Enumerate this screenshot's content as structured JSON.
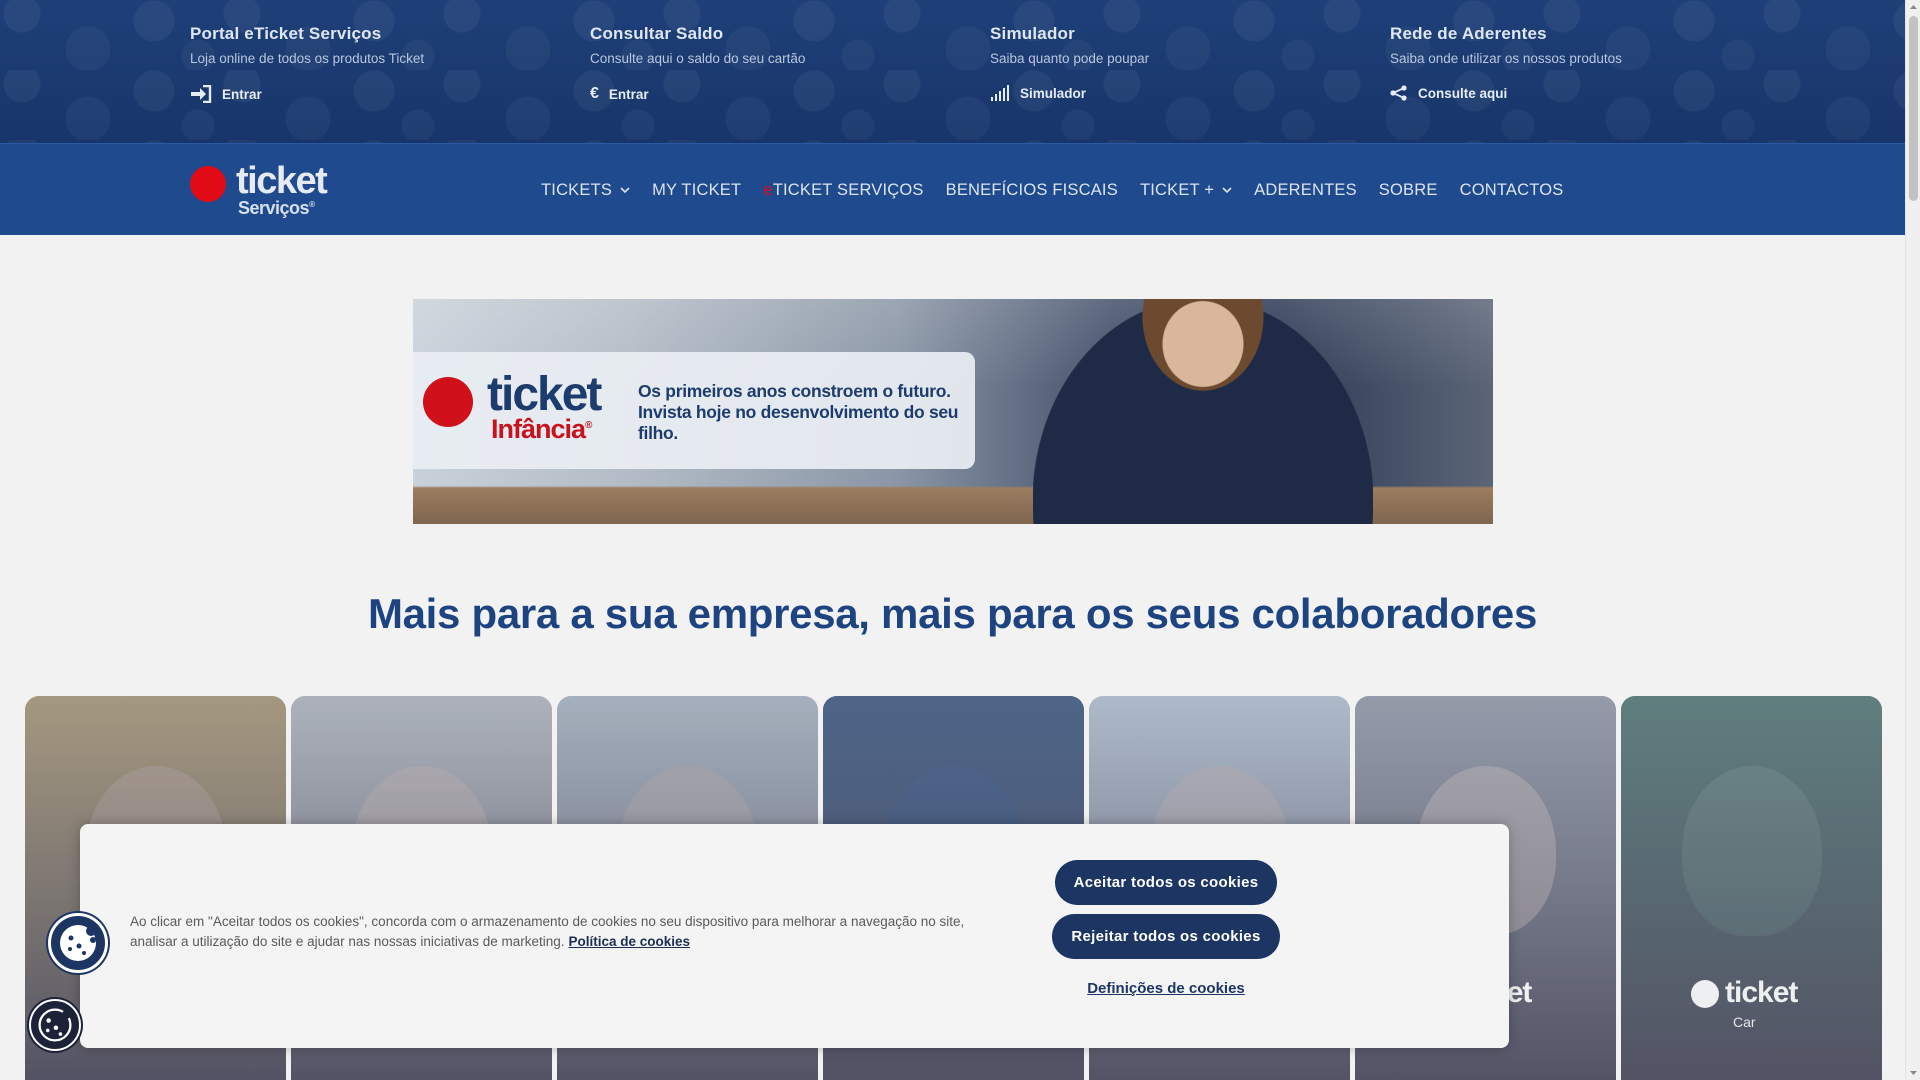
{
  "utility_links": [
    {
      "title": "Portal eTicket Serviços",
      "subtitle": "Loja online de todos os produtos Ticket",
      "action": "Entrar",
      "icon": "login-icon"
    },
    {
      "title": "Consultar Saldo",
      "subtitle": "Consulte aqui o saldo do seu cartão",
      "action": "Entrar",
      "icon": "euro-icon"
    },
    {
      "title": "Simulador",
      "subtitle": "Saiba quanto pode poupar",
      "action": "Simulador",
      "icon": "signal-bars-icon"
    },
    {
      "title": "Rede de Aderentes",
      "subtitle": "Saiba onde utilizar os nossos produtos",
      "action": "Consulte aqui",
      "icon": "share-icon"
    }
  ],
  "logo": {
    "word1": "ticket",
    "word2": "Serviços",
    "mark": "®"
  },
  "nav": {
    "items": [
      {
        "label": "TICKETS",
        "dropdown": true
      },
      {
        "label": "MY TICKET",
        "dropdown": false
      },
      {
        "prefix": "e",
        "label": "TICKET SERVIÇOS",
        "dropdown": false
      },
      {
        "label": "BENEFÍCIOS FISCAIS",
        "dropdown": false
      },
      {
        "label": "TICKET +",
        "dropdown": true
      },
      {
        "label": "ADERENTES",
        "dropdown": false
      },
      {
        "label": "SOBRE",
        "dropdown": false
      },
      {
        "label": "CONTACTOS",
        "dropdown": false
      }
    ]
  },
  "banner": {
    "logo_word1": "ticket",
    "logo_word2": "Infância",
    "mark": "®",
    "text": "Os primeiros anos constroem o futuro. Invista hoje no desenvolvimento do seu filho."
  },
  "headline": "Mais para a sua empresa, mais para os seus colaboradores",
  "cards": [
    {
      "tone": "#b8893c",
      "face": "#c99b7a",
      "logo": "",
      "sub": ""
    },
    {
      "tone": "#c7b9a8",
      "face": "#d8b59a",
      "logo": "",
      "sub": ""
    },
    {
      "tone": "#b9b4ab",
      "face": "#c9a98e",
      "logo": "",
      "sub": ""
    },
    {
      "tone": "#1b2c4c",
      "face": "#2a3d62",
      "logo": "",
      "sub": ""
    },
    {
      "tone": "#c9c7c3",
      "face": "#d4b59c",
      "logo": "",
      "sub": ""
    },
    {
      "tone": "#9a8f88",
      "face": "#e0c0a6",
      "logo": "ticket",
      "sub": "a"
    },
    {
      "tone": "#3c5a3a",
      "face": "#6b7b62",
      "logo": "ticket",
      "sub": "Car"
    }
  ],
  "cookie": {
    "message": "Ao clicar em \"Aceitar todos os cookies\", concorda com o armazenamento de cookies no seu dispositivo para melhorar a navegação no site, analisar a utilização do site e ajudar nas nossas iniciativas de marketing.",
    "policy_link": "Política de cookies",
    "accept": "Aceitar todos os cookies",
    "reject": "Rejeitar todos os cookies",
    "settings": "Definições de cookies"
  },
  "colors": {
    "brand_blue": "#1f4b8e",
    "brand_red": "#e20a16",
    "headline": "#1d4380",
    "button": "#1d3563"
  }
}
